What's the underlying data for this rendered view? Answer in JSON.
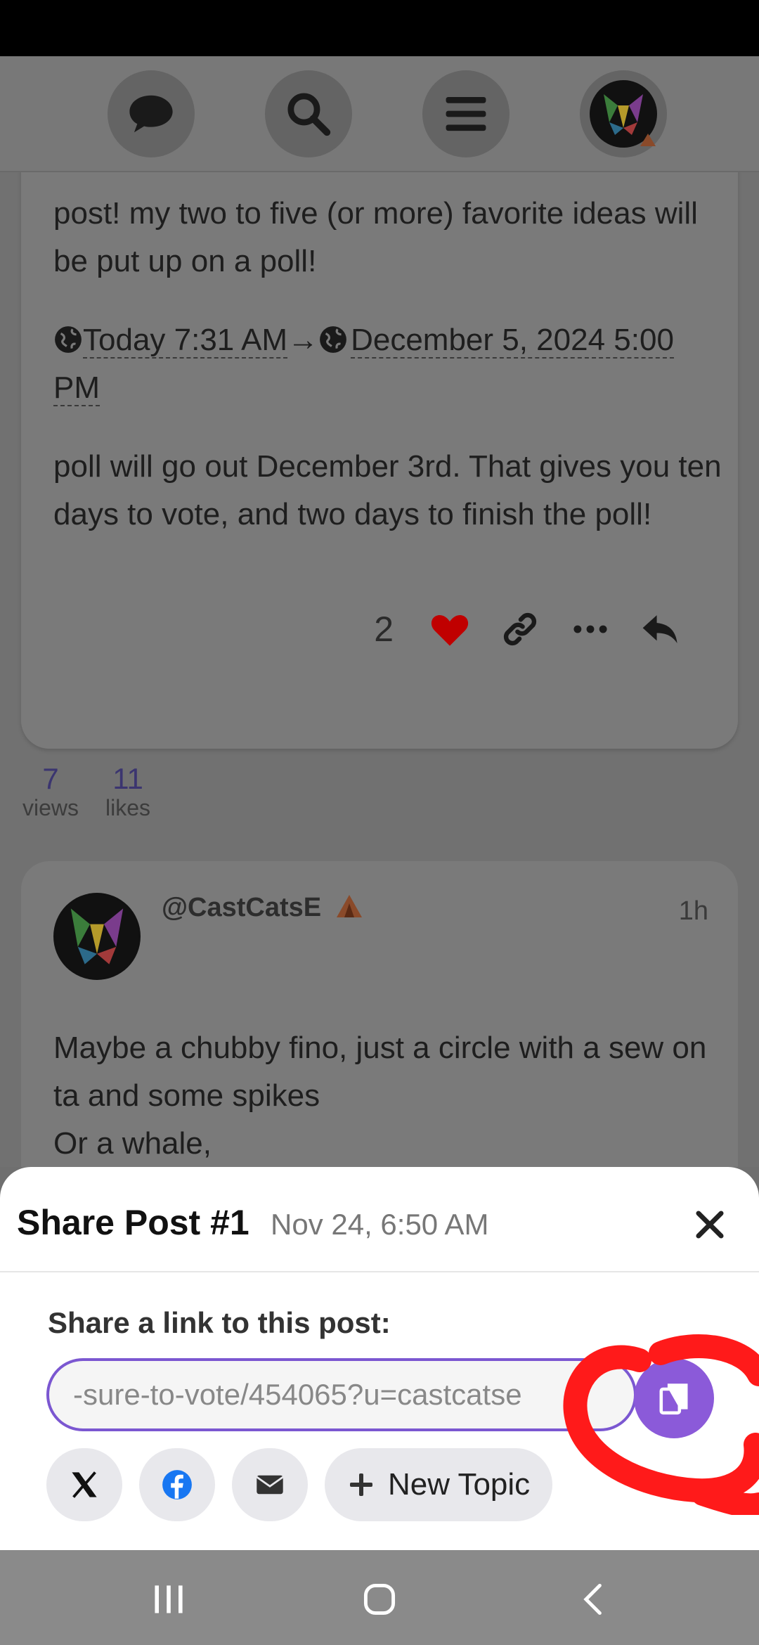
{
  "nav": {
    "icons": [
      "chat-icon",
      "search-icon",
      "menu-icon",
      "user-avatar"
    ]
  },
  "post1": {
    "text1": "post! my two to five (or more) favorite ideas will be put up on a poll!",
    "date_start": "Today 7:31 AM",
    "arrow": "→",
    "date_end": "December 5, 2024 5:00 PM",
    "text2": "poll will go out December 3rd. That gives you ten days to vote, and two days to finish the poll!",
    "like_count": "2"
  },
  "stats": {
    "views_num": "7",
    "views_label": "views",
    "likes_num": "11",
    "likes_label": "likes"
  },
  "post2": {
    "username": "@CastCatsE",
    "time": "1h",
    "text": "Maybe a chubby fino, just a circle with a sew on ta and some spikes\nOr a whale,"
  },
  "share": {
    "title": "Share Post #1",
    "date": "Nov 24, 6:50 AM",
    "label": "Share a link to this post:",
    "link": "-sure-to-vote/454065?u=castcatse",
    "new_topic": "New Topic"
  },
  "colors": {
    "accent": "#8b5ad9",
    "link_border": "#7b57d1",
    "heart": "#c00000",
    "annotation": "#ff1a1a"
  }
}
